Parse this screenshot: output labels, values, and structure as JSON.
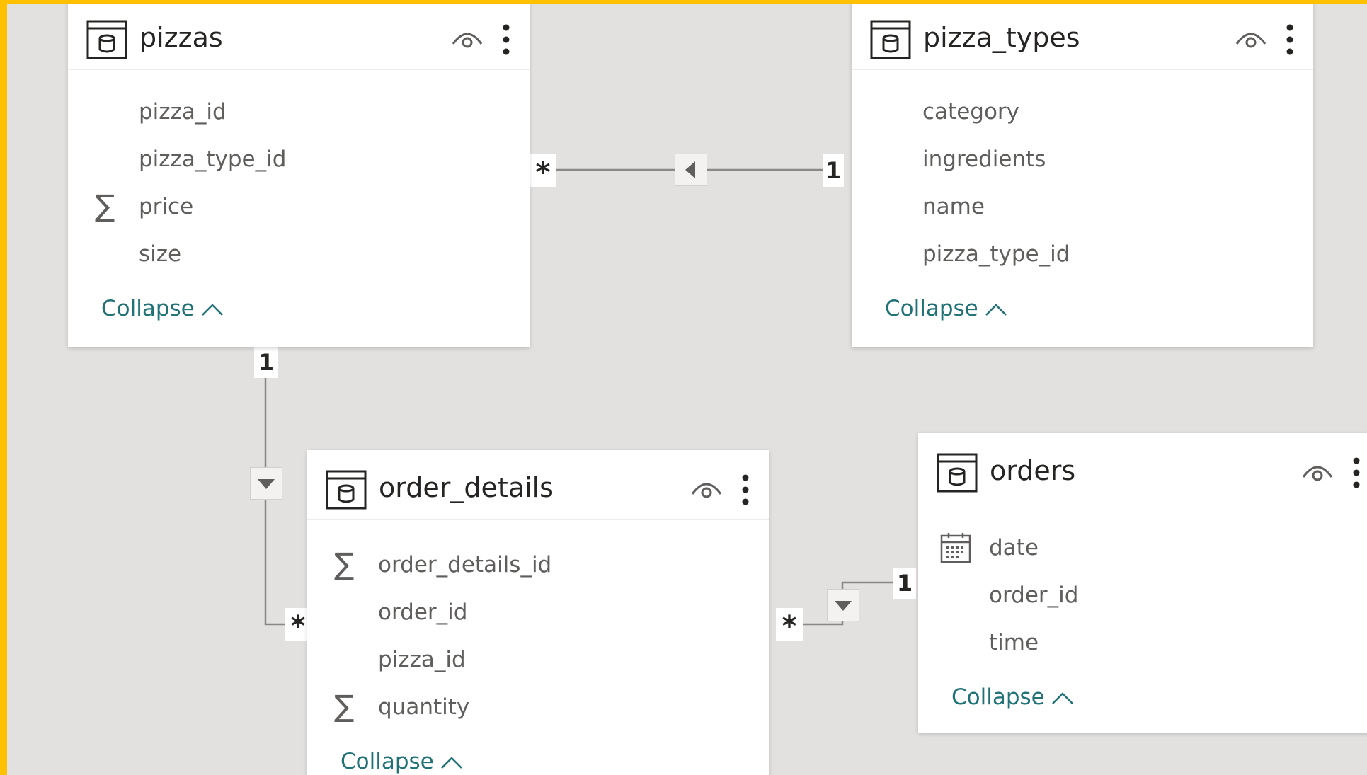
{
  "tables": {
    "pizzas": {
      "name": "pizzas",
      "fields": [
        "pizza_id",
        "pizza_type_id",
        "price",
        "size"
      ],
      "collapse_label": "Collapse"
    },
    "pizza_types": {
      "name": "pizza_types",
      "fields": [
        "category",
        "ingredients",
        "name",
        "pizza_type_id"
      ],
      "collapse_label": "Collapse"
    },
    "order_details": {
      "name": "order_details",
      "fields": [
        "order_details_id",
        "order_id",
        "pizza_id",
        "quantity"
      ],
      "collapse_label": "Collapse"
    },
    "orders": {
      "name": "orders",
      "fields": [
        "date",
        "order_id",
        "time"
      ],
      "collapse_label": "Collapse"
    }
  },
  "field_icons": {
    "pizzas.price": "sigma-icon",
    "order_details.order_details_id": "sigma-icon",
    "order_details.quantity": "sigma-icon",
    "orders.date": "calendar-icon"
  },
  "relationships": [
    {
      "from": "pizzas",
      "to": "pizza_types",
      "many_label": "*",
      "one_label": "1"
    },
    {
      "from": "pizzas",
      "to": "order_details",
      "many_label": "*",
      "one_label": "1"
    },
    {
      "from": "order_details",
      "to": "orders",
      "many_label": "*",
      "one_label": "1"
    }
  ],
  "colors": {
    "frame": "#ffc000",
    "canvas": "#e3e1df",
    "collapse_text": "#207277",
    "field_text": "#605e5c",
    "title_text": "#252423",
    "line": "#8a8886"
  }
}
